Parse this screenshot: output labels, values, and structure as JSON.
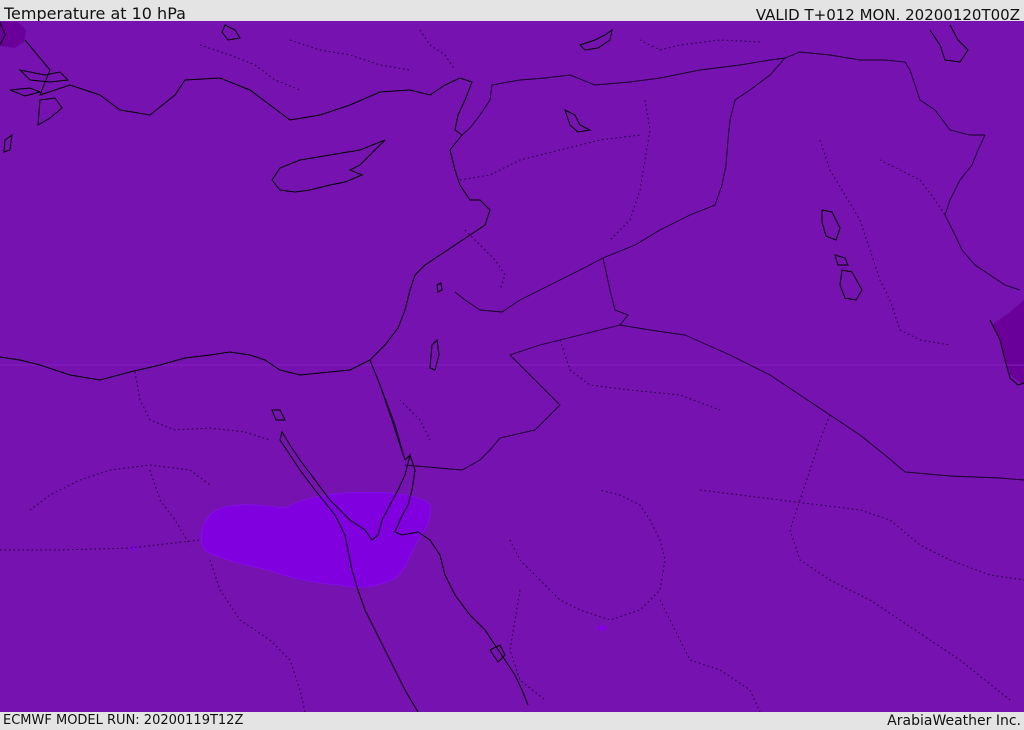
{
  "header": {
    "title": "Temperature at 10 hPa",
    "valid_time": "VALID T+012 MON. 20200120T00Z"
  },
  "footer": {
    "model_run": "ECMWF MODEL RUN: 20200119T12Z",
    "credit": "ArabiaWeather Inc."
  },
  "map": {
    "field": "temperature",
    "level": "10 hPa",
    "colors": {
      "base": "#7512b0",
      "warm_patch": "#8000e0",
      "dark_patch": "#6a0099",
      "coastline": "#000000",
      "border": "#1a0030"
    }
  }
}
